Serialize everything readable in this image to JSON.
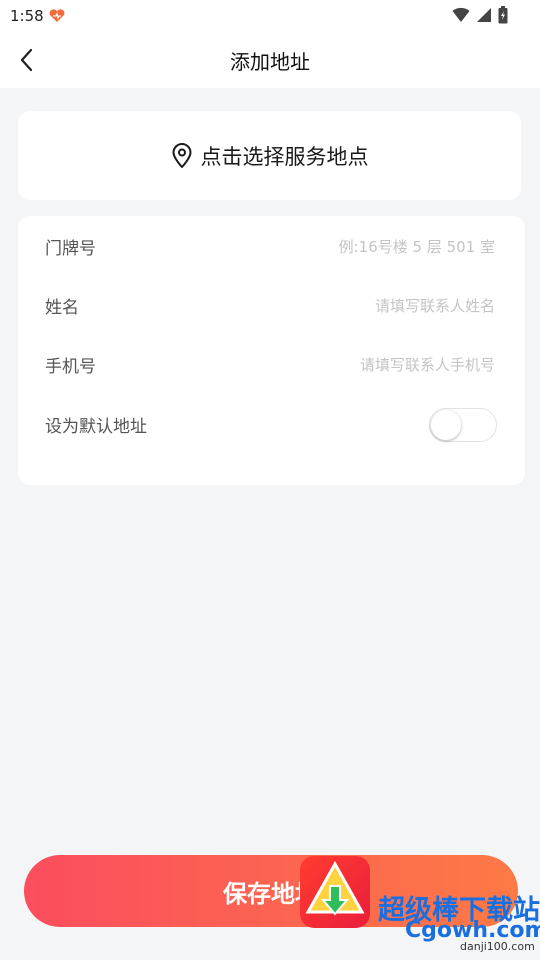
{
  "status_bar": {
    "time": "1:58",
    "app_icon": "heart-logo-icon",
    "icons": [
      "wifi-icon",
      "signal-icon",
      "battery-icon"
    ]
  },
  "header": {
    "back_icon": "chevron-left-icon",
    "title": "添加地址"
  },
  "location": {
    "icon": "map-pin-icon",
    "label": "点击选择服务地点"
  },
  "form": {
    "door_number": {
      "label": "门牌号",
      "value": "",
      "placeholder": "例:16号楼 5 层 501 室"
    },
    "name": {
      "label": "姓名",
      "value": "",
      "placeholder": "请填写联系人姓名"
    },
    "phone": {
      "label": "手机号",
      "value": "",
      "placeholder": "请填写联系人手机号"
    },
    "default": {
      "label": "设为默认地址",
      "checked": false
    }
  },
  "footer": {
    "save_label": "保存地址"
  },
  "watermark": {
    "text": "超级棒下载站",
    "sub": "Cgowh.com",
    "url": "danji100.com"
  },
  "colors": {
    "accent_start": "#fb4d5e",
    "accent_end": "#fd7a45",
    "background": "#f4f5f7",
    "watermark": "#1a6fe0"
  }
}
